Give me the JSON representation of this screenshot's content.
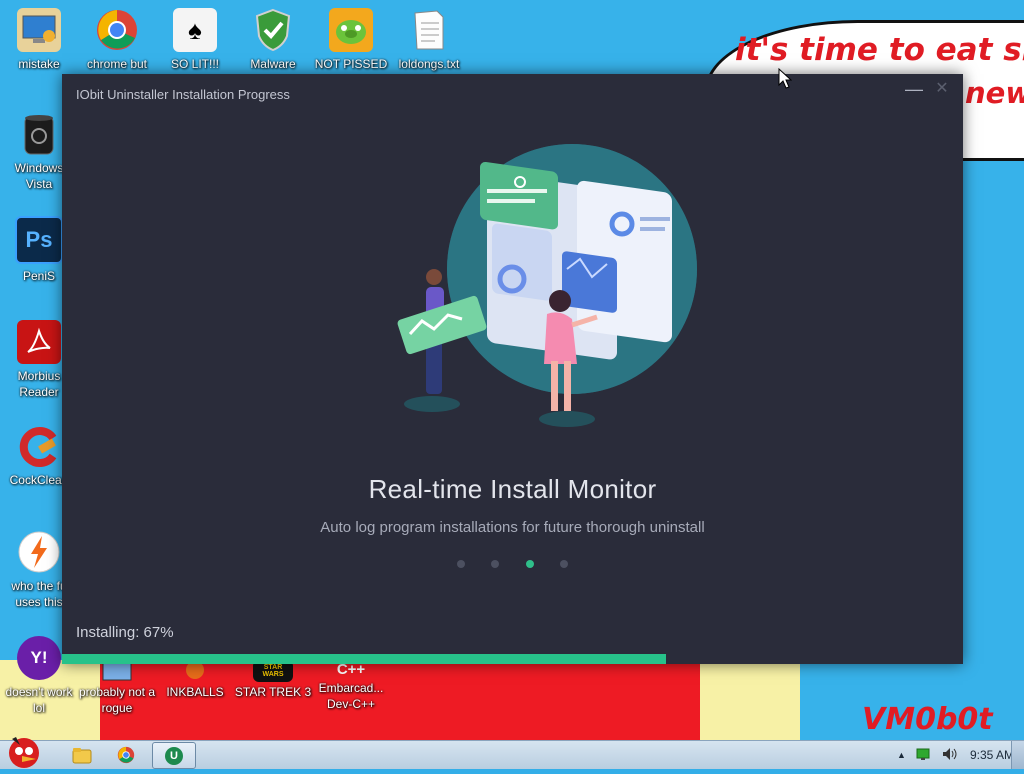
{
  "wallpaper": {
    "speech_line1": "it's time to eat shit",
    "speech_line2": "new",
    "signature": "VM0b0t"
  },
  "desktop_icons": [
    {
      "label": "mistake",
      "icon": "computer-icon"
    },
    {
      "label": "chrome but",
      "icon": "chrome-icon"
    },
    {
      "label": "SO LIT!!!",
      "icon": "solitaire-icon"
    },
    {
      "label": "Malware",
      "icon": "shield-check-icon"
    },
    {
      "label": "NOT PISSED",
      "icon": "angry-pig-icon"
    },
    {
      "label": "loldongs.txt",
      "icon": "text-file-icon"
    },
    {
      "label": "Windows Vista",
      "icon": "recycle-bin-icon"
    },
    {
      "label": "PeniS",
      "icon": "photoshop-icon",
      "glyph": "Ps"
    },
    {
      "label": "Morbius Reader",
      "icon": "acrobat-icon"
    },
    {
      "label": "CockClean",
      "icon": "ccleaner-icon"
    },
    {
      "label": "who the fu uses this",
      "icon": "lightning-icon"
    },
    {
      "label": "doesn't work lol",
      "icon": "yahoo-smiley-icon",
      "glyph": "Y!"
    },
    {
      "label": "probably not a rogue",
      "icon": "software-icon"
    },
    {
      "label": "INKBALLS",
      "icon": "inkball-icon"
    },
    {
      "label": "STAR TREK 3",
      "icon": "star-wars-icon",
      "glyph": "STAR WARS"
    },
    {
      "label": "Embarcad... Dev-C++",
      "icon": "devcpp-icon",
      "glyph": "C++"
    }
  ],
  "installer": {
    "title": "IObit Uninstaller Installation Progress",
    "minimize": "—",
    "close": "✕",
    "heading": "Real-time Install Monitor",
    "subheading": "Auto log program installations for future thorough uninstall",
    "carousel_active": 3,
    "carousel_count": 4,
    "status": "Installing: 67%",
    "progress": 0.67,
    "accent": "#27c28a"
  },
  "taskbar": {
    "pinned": [
      "explorer-icon",
      "chrome-icon"
    ],
    "active_app": "iobit-uninstaller-icon",
    "active_glyph": "U",
    "clock": "9:35 AM"
  }
}
